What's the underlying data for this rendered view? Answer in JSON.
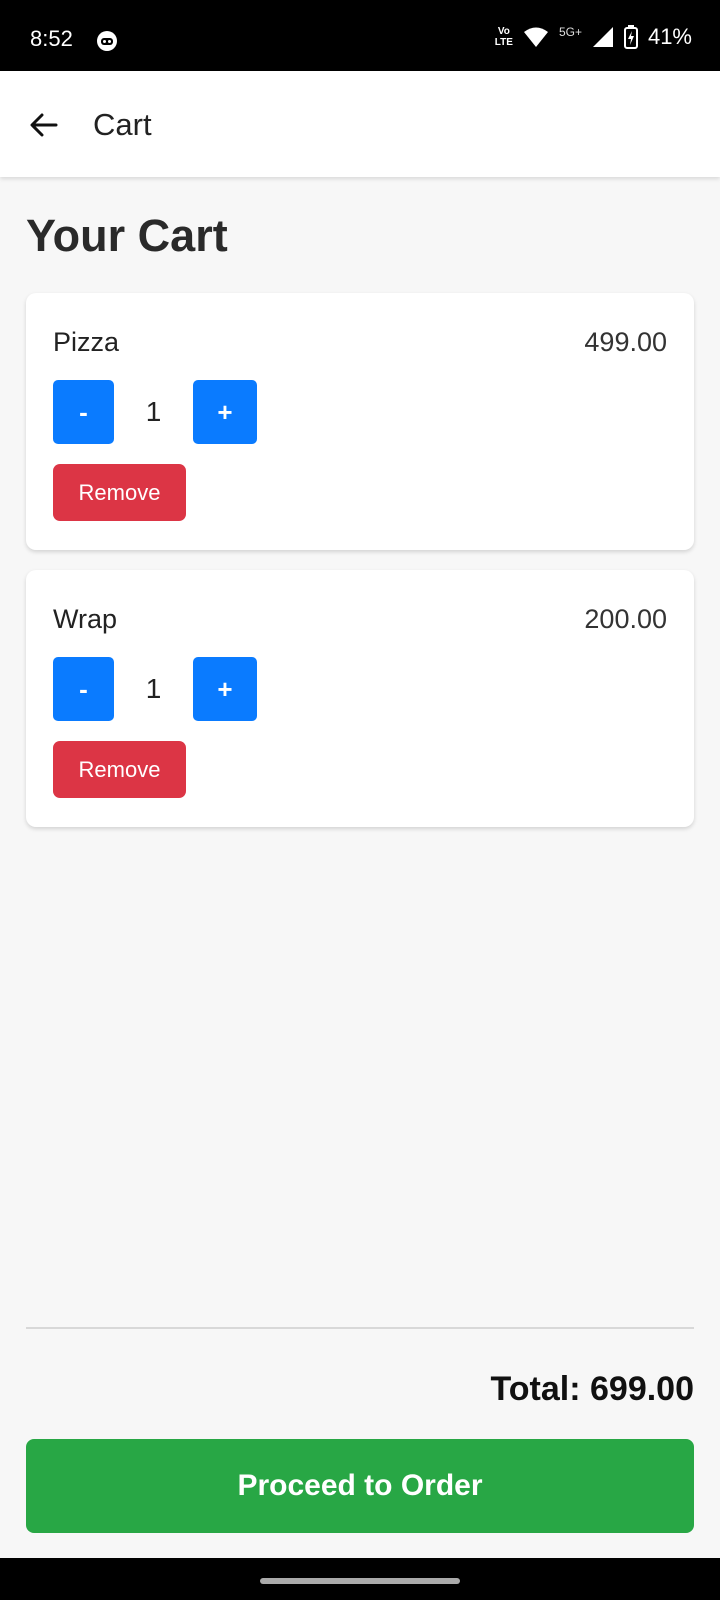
{
  "status_bar": {
    "time": "8:52",
    "volte_top": "Vo",
    "volte_bottom": "LTE",
    "network": "5G+",
    "battery": "41%"
  },
  "app_bar": {
    "title": "Cart"
  },
  "page": {
    "title": "Your Cart"
  },
  "cart": {
    "items": [
      {
        "name": "Pizza",
        "price": "499.00",
        "quantity": "1",
        "minus_label": "-",
        "plus_label": "+",
        "remove_label": "Remove"
      },
      {
        "name": "Wrap",
        "price": "200.00",
        "quantity": "1",
        "minus_label": "-",
        "plus_label": "+",
        "remove_label": "Remove"
      }
    ]
  },
  "summary": {
    "total": "Total: 699.00",
    "proceed_label": "Proceed to Order"
  },
  "colors": {
    "primary": "#0a7bff",
    "danger": "#dc3545",
    "success": "#28a745"
  }
}
